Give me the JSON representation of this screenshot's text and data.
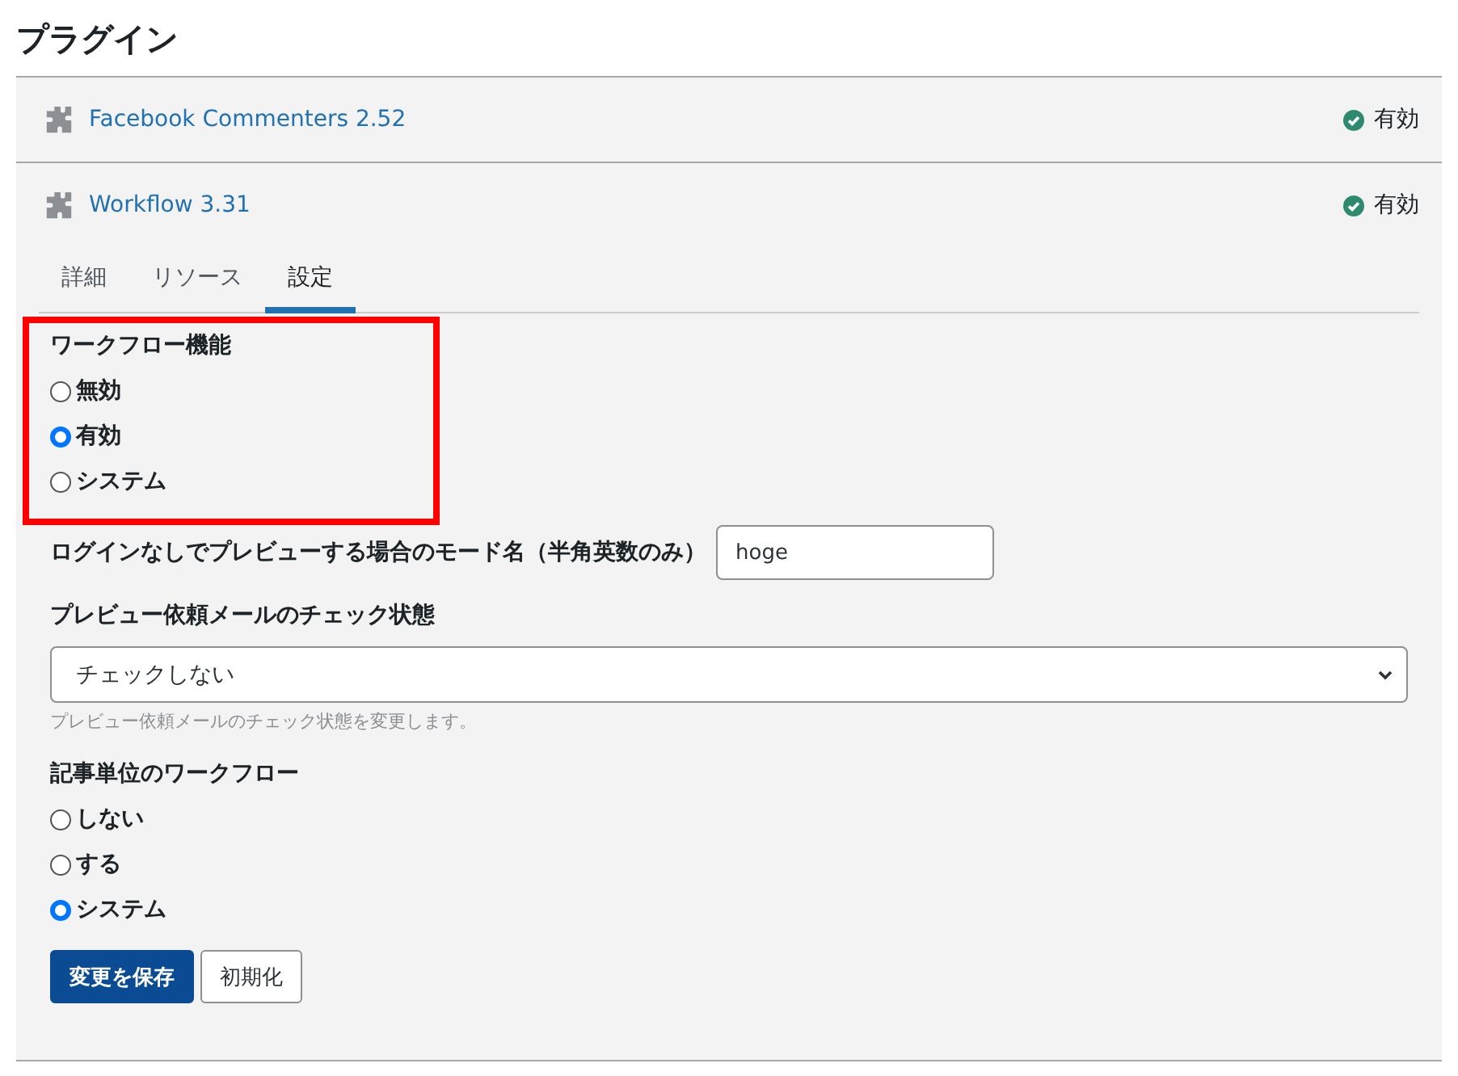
{
  "page_title": "プラグイン",
  "plugins": [
    {
      "name": "Facebook Commenters 2.52",
      "status": "有効",
      "active": true,
      "expanded": false
    },
    {
      "name": "Workflow 3.31",
      "status": "有効",
      "active": true,
      "expanded": true,
      "tabs": [
        {
          "label": "詳細",
          "selected": false
        },
        {
          "label": "リソース",
          "selected": false
        },
        {
          "label": "設定",
          "selected": true
        }
      ],
      "settings": [
        {
          "kind": "radio-group",
          "label": "ワークフロー機能",
          "highlighted": true,
          "options": [
            {
              "label": "無効",
              "selected": false
            },
            {
              "label": "有効",
              "selected": true
            },
            {
              "label": "システム",
              "selected": false
            }
          ]
        },
        {
          "kind": "text",
          "label": "ログインなしでプレビューする場合のモード名（半角英数のみ）",
          "value": "hoge"
        },
        {
          "kind": "select",
          "label": "プレビュー依頼メールのチェック状態",
          "value": "チェックしない",
          "hint": "プレビュー依頼メールのチェック状態を変更します。"
        },
        {
          "kind": "radio-group",
          "label": "記事単位のワークフロー",
          "highlighted": false,
          "options": [
            {
              "label": "しない",
              "selected": false
            },
            {
              "label": "する",
              "selected": false
            },
            {
              "label": "システム",
              "selected": true
            }
          ]
        }
      ],
      "buttons": [
        {
          "label": "変更を保存",
          "kind": "primary"
        },
        {
          "label": "初期化",
          "kind": "secondary"
        }
      ]
    }
  ]
}
